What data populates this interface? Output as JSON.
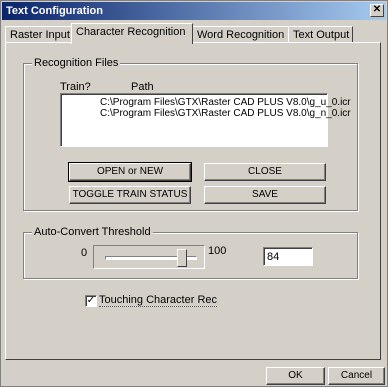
{
  "window": {
    "title": "Text Configuration",
    "close_glyph": "✕"
  },
  "tabs": [
    {
      "label": "Raster Input"
    },
    {
      "label": "Character Recognition"
    },
    {
      "label": "Word Recognition"
    },
    {
      "label": "Text Output"
    }
  ],
  "recognition": {
    "group_label": "Recognition Files",
    "col_train": "Train?",
    "col_path": "Path",
    "files": [
      "C:\\Program Files\\GTX\\Raster CAD PLUS V8.0\\g_u_0.icr",
      "C:\\Program Files\\GTX\\Raster CAD PLUS V8.0\\g_n_0.icr"
    ],
    "open_new": "OPEN or NEW",
    "close": "CLOSE",
    "toggle": "TOGGLE TRAIN STATUS",
    "save": "SAVE"
  },
  "threshold": {
    "group_label": "Auto-Convert Threshold",
    "min": "0",
    "max": "100",
    "value": "84",
    "level": 0.84
  },
  "touching": {
    "label": "Touching Character Rec",
    "checked": true,
    "check_glyph": "✓"
  },
  "footer": {
    "ok": "OK",
    "cancel": "Cancel"
  }
}
